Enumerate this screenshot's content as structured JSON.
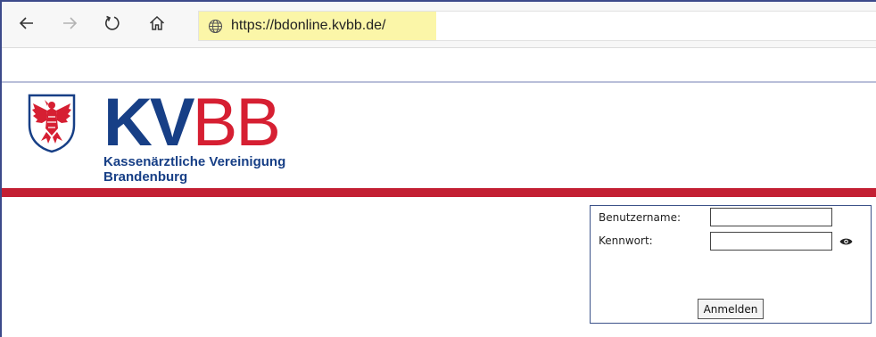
{
  "browser": {
    "url": "https://bdonline.kvbb.de/",
    "icons": [
      "back-arrow-icon",
      "forward-arrow-icon",
      "refresh-icon",
      "home-icon",
      "globe-icon"
    ]
  },
  "header": {
    "brand_kv": "KV",
    "brand_bb": "BB",
    "subtitle_line1": "Kassenärztliche Vereinigung",
    "subtitle_line2": "Brandenburg",
    "colors": {
      "blue": "#173f86",
      "red": "#d61f32",
      "bar_red": "#c31f33"
    }
  },
  "login": {
    "username_label": "Benutzername:",
    "username_value": "",
    "password_label": "Kennwort:",
    "password_value": "",
    "submit_label": "Anmelden",
    "show_password_icon": "eye-icon"
  }
}
